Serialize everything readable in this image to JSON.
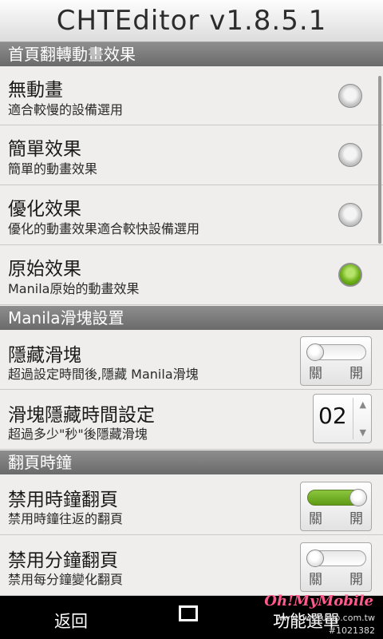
{
  "title": "CHTEditor v1.8.5.1",
  "sections": [
    {
      "label": "首頁翻轉動畫效果"
    },
    {
      "label": "Manila滑塊設置"
    },
    {
      "label": "翻頁時鐘"
    }
  ],
  "animation_options": [
    {
      "title": "無動畫",
      "subtitle": "適合較慢的設備選用",
      "selected": false
    },
    {
      "title": "簡單效果",
      "subtitle": "簡單的動畫效果",
      "selected": false
    },
    {
      "title": "優化效果",
      "subtitle": "優化的動畫效果適合較快設備選用",
      "selected": false
    },
    {
      "title": "原始效果",
      "subtitle": "Manila原始的動畫效果",
      "selected": true
    }
  ],
  "slider_settings": {
    "hide_slider": {
      "title": "隱藏滑塊",
      "subtitle": "超過設定時間後,隱藏 Manila滑塊",
      "off_label": "關",
      "on_label": "開",
      "enabled": false
    },
    "hide_time": {
      "title": "滑塊隱藏時間設定",
      "subtitle": "超過多少\"秒\"後隱藏滑塊",
      "value": "02"
    }
  },
  "clock_settings": [
    {
      "title": "禁用時鐘翻頁",
      "subtitle": "禁用時鐘往返的翻頁",
      "off_label": "關",
      "on_label": "開",
      "enabled": true
    },
    {
      "title": "禁用分鐘翻頁",
      "subtitle": "禁用每分鐘變化翻頁",
      "off_label": "關",
      "on_label": "開",
      "enabled": false
    }
  ],
  "navbar": {
    "back_label": "返回",
    "menu_label": "功能選單"
  },
  "watermark": {
    "logo": "Oh!MyMobile",
    "url": "www.qweruiop.com.tw",
    "id": "#1021382"
  },
  "colors": {
    "accent_green": "#6fb21a",
    "section_bg": "#7a7a7a",
    "nav_bg": "#000000"
  }
}
